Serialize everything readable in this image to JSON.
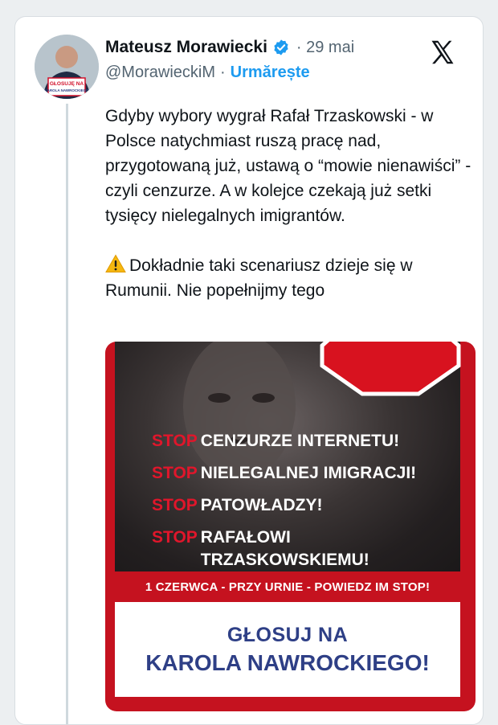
{
  "tweet": {
    "author_name": "Mateusz Morawiecki",
    "date": "· 29 mai",
    "handle": "@MorawieckiM",
    "separator": "·",
    "follow_label": "Urmărește",
    "paragraph1": "Gdyby wybory wygrał Rafał Trzaskowski - w Polsce natychmiast ruszą pracę nad, przygotowaną już, ustawą o “mowie nienawiści” - czyli cenzurze. A w kolejce czekają już setki tysięcy nielegalnych imigrantów.",
    "paragraph2": "Dokładnie taki scenariusz dzieje się w Rumunii. Nie popełnijmy tego"
  },
  "avatar": {
    "badge_line1": "GŁOSUJĘ NA",
    "badge_line2": "KAROLA NAWROCKIEGO"
  },
  "media": {
    "slogans": [
      {
        "stop": "STOP",
        "text": "CENZURZE INTERNETU!"
      },
      {
        "stop": "STOP",
        "text": "NIELEGALNEJ IMIGRACJI!"
      },
      {
        "stop": "STOP",
        "text": "PATOWŁADZY!"
      },
      {
        "stop": "STOP",
        "text": "RAFAŁOWI TRZASKOWSKIEMU!"
      }
    ],
    "date_line": "1 CZERWCA - PRZY URNIE - POWIEDZ IM STOP!",
    "vote_line1": "GŁOSUJ NA",
    "vote_line2": "KAROLA NAWROCKIEGO!"
  },
  "colors": {
    "verified": "#1d9bf0",
    "follow": "#1d9bf0",
    "stop_red": "#e0162b",
    "campaign_navy": "#2e3f86"
  },
  "icons": [
    "verified-badge-icon",
    "x-logo-icon",
    "warning-icon"
  ]
}
